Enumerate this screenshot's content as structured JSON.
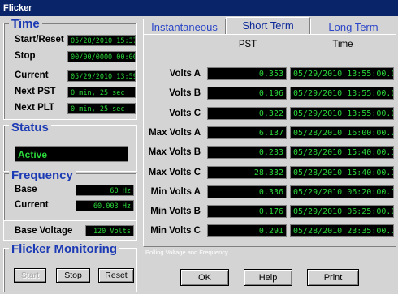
{
  "window": {
    "title": "Flicker"
  },
  "time": {
    "legend": "Time",
    "rows": [
      {
        "label": "Start/Reset",
        "value": "05/28/2010 15:37:55"
      },
      {
        "label": "Stop",
        "value": "00/00/0000 00:00:00"
      },
      {
        "label": "Current",
        "value": "05/29/2010 13:59:35"
      },
      {
        "label": "Next PST",
        "value": "0 min, 25 sec"
      },
      {
        "label": "Next PLT",
        "value": "0 min, 25 sec"
      }
    ]
  },
  "status": {
    "legend": "Status",
    "value": "Active"
  },
  "frequency": {
    "legend": "Frequency",
    "base_label": "Base",
    "base_value": "60 Hz",
    "current_label": "Current",
    "current_value": "60.003 Hz"
  },
  "base_voltage": {
    "label": "Base Voltage",
    "value": "120 Volts"
  },
  "flicker_monitoring": {
    "legend": "Flicker Monitoring",
    "start_label": "Start",
    "stop_label": "Stop",
    "reset_label": "Reset"
  },
  "tabs": [
    {
      "label": "Instantaneous",
      "active": false
    },
    {
      "label": "Short Term",
      "active": true
    },
    {
      "label": "Long Term",
      "active": false
    }
  ],
  "table": {
    "col_pst": "PST",
    "col_time": "Time",
    "rows": [
      {
        "label": "Volts A",
        "pst": "0.353",
        "time": "05/29/2010 13:55:00.09"
      },
      {
        "label": "Volts B",
        "pst": "0.196",
        "time": "05/29/2010 13:55:00.09"
      },
      {
        "label": "Volts C",
        "pst": "0.322",
        "time": "05/29/2010 13:55:00.09"
      },
      {
        "label": "Max Volts A",
        "pst": "6.137",
        "time": "05/28/2010 16:00:00.23"
      },
      {
        "label": "Max Volts B",
        "pst": "0.233",
        "time": "05/28/2010 15:40:00.12"
      },
      {
        "label": "Max Volts C",
        "pst": "28.332",
        "time": "05/28/2010 15:40:00.12"
      },
      {
        "label": "Min Volts A",
        "pst": "0.336",
        "time": "05/29/2010 06:20:00.16"
      },
      {
        "label": "Min Volts B",
        "pst": "0.176",
        "time": "05/29/2010 06:25:00.09"
      },
      {
        "label": "Min Volts C",
        "pst": "0.291",
        "time": "05/28/2010 23:35:00.13"
      }
    ]
  },
  "footer": {
    "message": "Polling Voltage and Frequency",
    "ok_label": "OK",
    "help_label": "Help",
    "print_label": "Print"
  },
  "colors": {
    "lcd_text": "#2ad63a",
    "lcd_bg": "#000000",
    "legend": "#1c3ab4",
    "titlebar": "#0a246a"
  }
}
